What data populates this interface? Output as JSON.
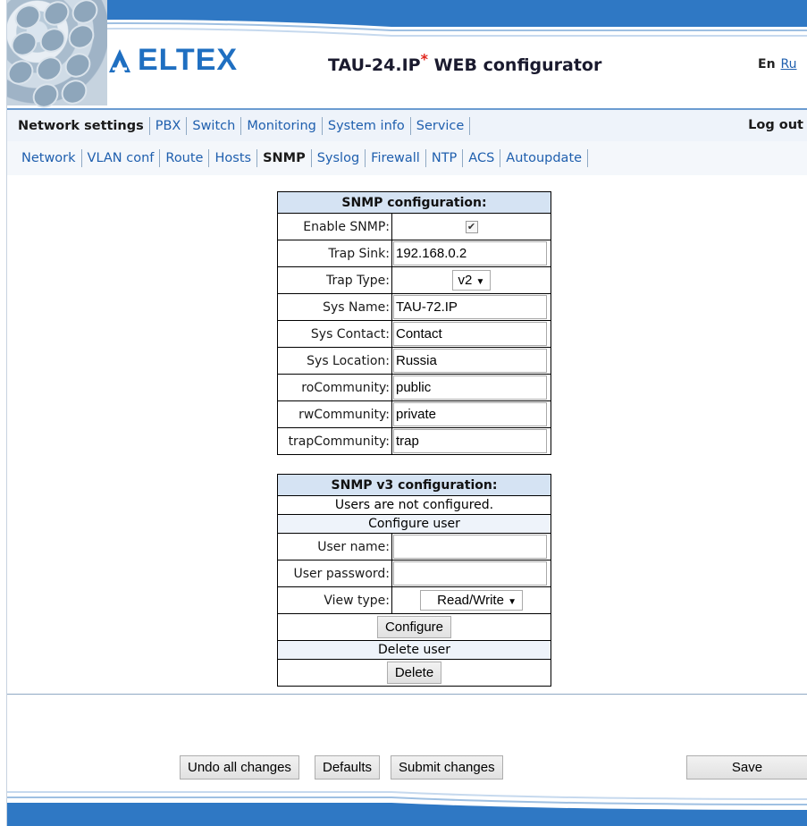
{
  "header": {
    "logo_text": "ELTEX",
    "app_title": "TAU-24.IP",
    "app_title_star": "*",
    "app_title_suffix": " WEB configurator",
    "lang_en": "En",
    "lang_ru": "Ru"
  },
  "nav": {
    "primary": [
      "Network settings",
      "PBX",
      "Switch",
      "Monitoring",
      "System info",
      "Service"
    ],
    "primary_active": "Network settings",
    "logout": "Log out",
    "secondary": [
      "Network",
      "VLAN conf",
      "Route",
      "Hosts",
      "SNMP",
      "Syslog",
      "Firewall",
      "NTP",
      "ACS",
      "Autoupdate"
    ],
    "secondary_active": "SNMP"
  },
  "snmp": {
    "title": "SNMP configuration:",
    "enable_label": "Enable SNMP:",
    "enable_checked": true,
    "trap_sink_label": "Trap Sink:",
    "trap_sink_value": "192.168.0.2",
    "trap_type_label": "Trap Type:",
    "trap_type_value": "v2",
    "sys_name_label": "Sys Name:",
    "sys_name_value": "TAU-72.IP",
    "sys_contact_label": "Sys Contact:",
    "sys_contact_value": "Contact",
    "sys_location_label": "Sys Location:",
    "sys_location_value": "Russia",
    "ro_label": "roCommunity:",
    "ro_value": "public",
    "rw_label": "rwCommunity:",
    "rw_value": "private",
    "trap_comm_label": "trapCommunity:",
    "trap_comm_value": "trap"
  },
  "snmpv3": {
    "title": "SNMP v3 configuration:",
    "info": "Users are not configured.",
    "configure_header": "Configure user",
    "user_name_label": "User name:",
    "user_name_value": "",
    "user_password_label": "User password:",
    "user_password_value": "",
    "view_type_label": "View type:",
    "view_type_value": "Read/Write",
    "configure_button": "Configure",
    "delete_header": "Delete user",
    "delete_button": "Delete"
  },
  "footer": {
    "undo_button": "Undo all changes",
    "defaults_button": "Defaults",
    "submit_button": "Submit changes",
    "save_button": "Save"
  },
  "colors": {
    "accent_blue": "#2f78c4",
    "table_header": "#d5e3f3",
    "link_blue": "#1f5fae"
  }
}
